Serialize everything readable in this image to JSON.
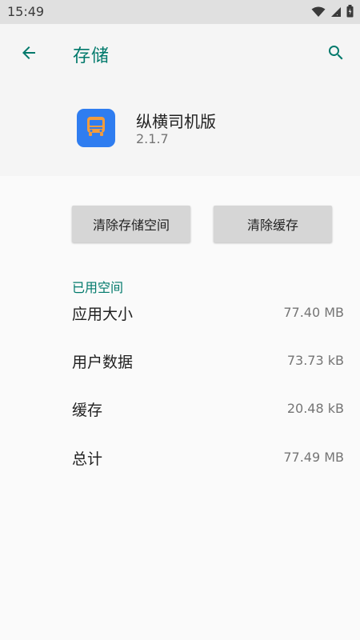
{
  "status_bar": {
    "time": "15:49"
  },
  "toolbar": {
    "title": "存储"
  },
  "app": {
    "name": "纵横司机版",
    "version": "2.1.7"
  },
  "buttons": {
    "clear_storage": "清除存储空间",
    "clear_cache": "清除缓存"
  },
  "storage": {
    "section_label": "已用空间",
    "rows": [
      {
        "label": "应用大小",
        "value": "77.40 MB"
      },
      {
        "label": "用户数据",
        "value": "73.73 kB"
      },
      {
        "label": "缓存",
        "value": "20.48 kB"
      },
      {
        "label": "总计",
        "value": "77.49 MB"
      }
    ]
  },
  "colors": {
    "accent": "#00796b",
    "app_icon_bg": "#2f7df0",
    "app_icon_fg": "#f39c3d"
  },
  "icons": [
    "back-arrow-icon",
    "search-icon",
    "wifi-icon",
    "signal-icon",
    "battery-icon",
    "bus-icon"
  ]
}
